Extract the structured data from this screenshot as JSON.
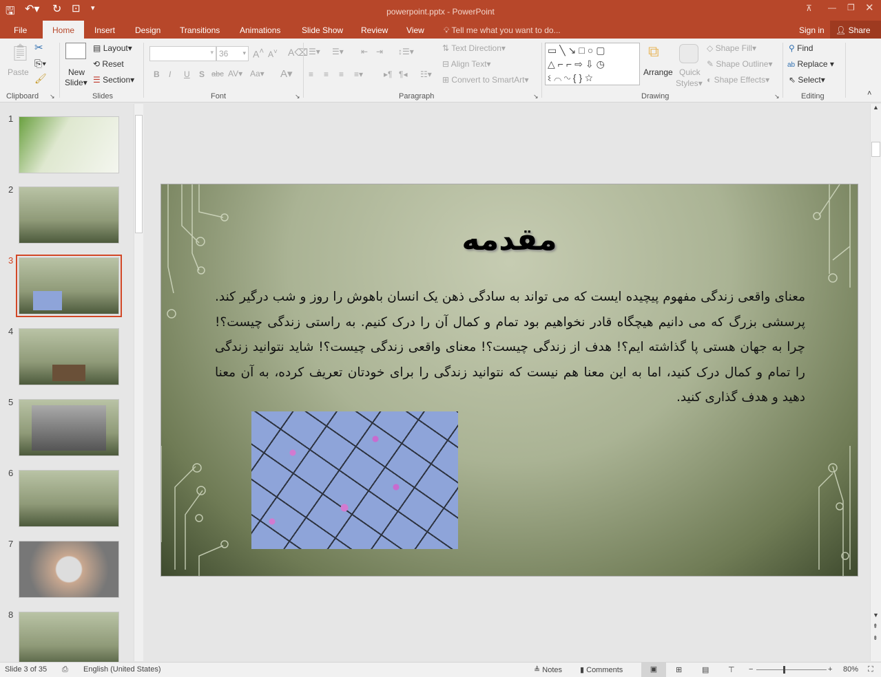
{
  "app": {
    "title": "powerpoint.pptx - PowerPoint",
    "accent": "#b7472a"
  },
  "qat": {
    "icons": [
      "save-icon",
      "undo-icon",
      "redo-icon",
      "present-icon",
      "customize-icon"
    ]
  },
  "tabs": [
    "File",
    "Home",
    "Insert",
    "Design",
    "Transitions",
    "Animations",
    "Slide Show",
    "Review",
    "View"
  ],
  "active_tab": "Home",
  "tell_me": "Tell me what you want to do...",
  "sign_in": "Sign in",
  "share": "Share",
  "ribbon": {
    "clipboard": {
      "label": "Clipboard",
      "paste": "Paste"
    },
    "slides": {
      "label": "Slides",
      "new_slide_1": "New",
      "new_slide_2": "Slide",
      "layout": "Layout",
      "reset": "Reset",
      "section": "Section"
    },
    "font": {
      "label": "Font",
      "font_name": "",
      "font_size": "36"
    },
    "paragraph": {
      "label": "Paragraph",
      "text_direction": "Text Direction",
      "align_text": "Align Text",
      "convert_smartart": "Convert to SmartArt"
    },
    "drawing": {
      "label": "Drawing",
      "arrange": "Arrange",
      "quick_styles_1": "Quick",
      "quick_styles_2": "Styles",
      "shape_fill": "Shape Fill",
      "shape_outline": "Shape Outline",
      "shape_effects": "Shape Effects"
    },
    "editing": {
      "label": "Editing",
      "find": "Find",
      "replace": "Replace",
      "select": "Select"
    }
  },
  "thumbnails": [
    "1",
    "2",
    "3",
    "4",
    "5",
    "6",
    "7",
    "8"
  ],
  "selected_slide": 3,
  "slide": {
    "title": "مقدمه",
    "body": "معنای واقعی زندگی مفهوم پیچیده ایست که می تواند به سادگی ذهن یک انسان باهوش را روز و شب درگیر کند. پرسشی بزرگ که می دانیم هیچگاه قادر نخواهیم بود تمام و کمال آن را درک کنیم. به راستی زندگی چیست؟! چرا به جهان هستی پا گذاشته ایم؟! هدف از زندگی چیست؟! معنای واقعی زندگی چیست؟! شاید نتوانید زندگی را تمام و کمال درک کنید، اما به این معنا هم نیست که نتوانید زندگی را برای خودتان تعریف کرده، به آن معنا دهید و هدف گذاری کنید."
  },
  "status": {
    "slide_info": "Slide 3 of 35",
    "language": "English (United States)",
    "notes": "Notes",
    "comments": "Comments",
    "zoom": "80%",
    "zoom_value": 80
  }
}
